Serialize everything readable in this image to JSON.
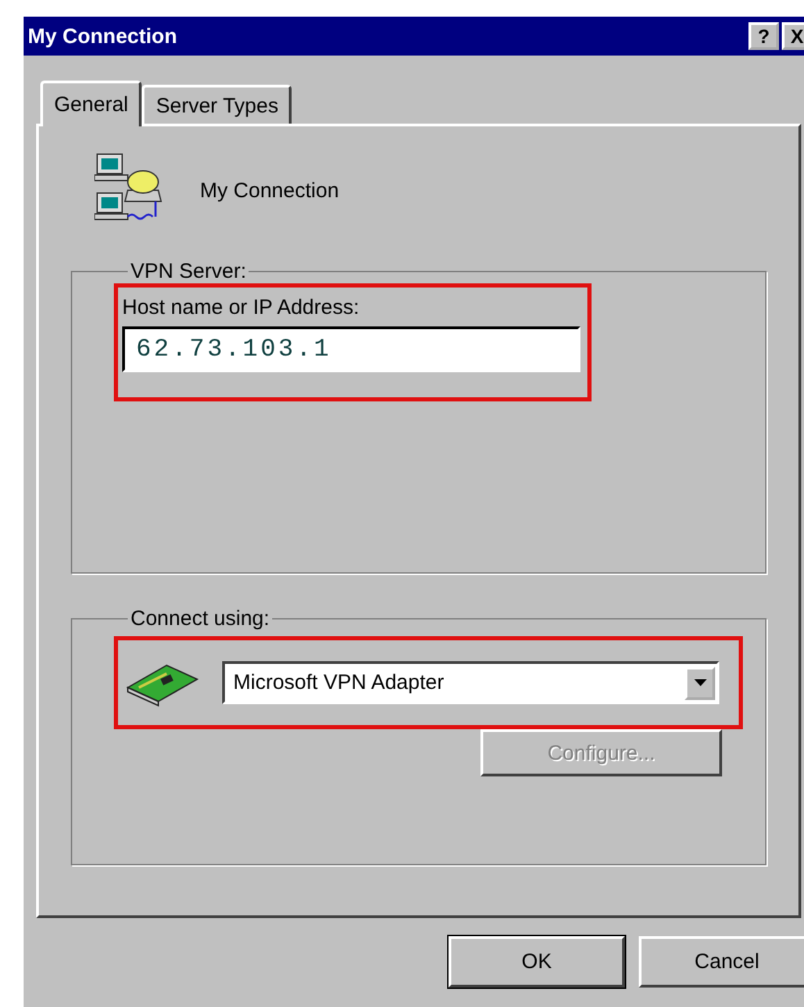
{
  "window": {
    "title": "My Connection",
    "help_button": "?",
    "close_button": "X"
  },
  "tabs": [
    {
      "label": "General",
      "selected": true
    },
    {
      "label": "Server Types",
      "selected": false
    }
  ],
  "connection_name": "My Connection",
  "vpn_server": {
    "title": "VPN Server:",
    "host_label": "Host name or IP Address:",
    "host_value": "62.73.103.1",
    "highlighted": true
  },
  "connect_using": {
    "title": "Connect using:",
    "adapter": "Microsoft VPN Adapter",
    "highlighted": true,
    "configure": {
      "label": "Configure...",
      "disabled": true
    }
  },
  "buttons": [
    {
      "label": "OK",
      "default": true
    },
    {
      "label": "Cancel",
      "default": false
    }
  ]
}
